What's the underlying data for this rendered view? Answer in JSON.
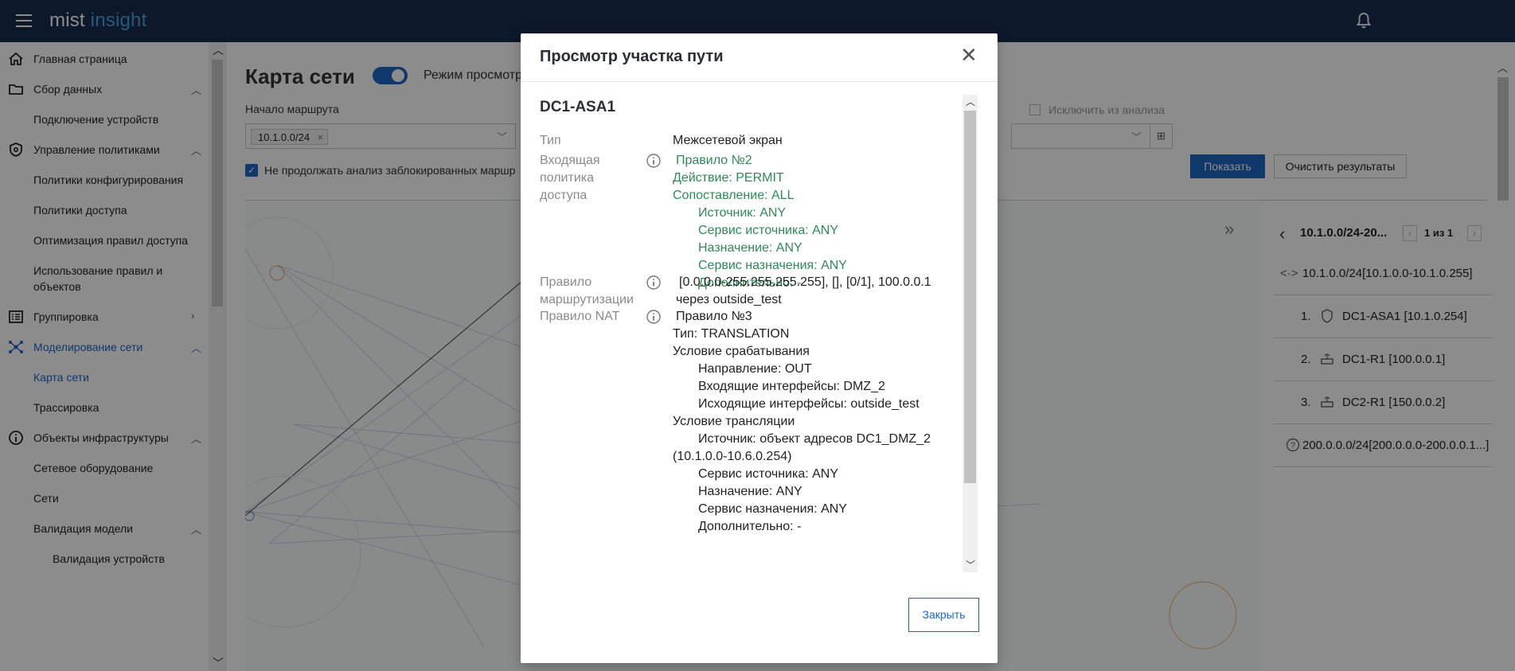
{
  "app": {
    "logo_part1": "mist",
    "logo_part2": "insight"
  },
  "sidebar": {
    "items": [
      {
        "label": "Главная страница"
      },
      {
        "label": "Сбор данных"
      },
      {
        "label": "Подключение устройств"
      },
      {
        "label": "Управление политиками"
      },
      {
        "label": "Политики конфигурирования"
      },
      {
        "label": "Политики доступа"
      },
      {
        "label": "Оптимизация правил доступа"
      },
      {
        "label": "Использование правил и"
      },
      {
        "label": "объектов"
      },
      {
        "label": "Группировка"
      },
      {
        "label": "Моделирование сети"
      },
      {
        "label": "Карта сети"
      },
      {
        "label": "Трассировка"
      },
      {
        "label": "Объекты инфраструктуры"
      },
      {
        "label": "Сетевое оборудование"
      },
      {
        "label": "Сети"
      },
      {
        "label": "Валидация модели"
      },
      {
        "label": "Валидация устройств"
      }
    ],
    "active_color": "#1f66c4"
  },
  "main": {
    "title": "Карта сети",
    "mode_label": "Режим просмотр",
    "route_start_label": "Начало маршрута",
    "route_chip": "10.1.0.0/24",
    "no_continue_label": "Не продолжать анализ заблокированных маршр",
    "exclude_label": "Исключить из анализа",
    "show_button": "Показать",
    "clear_button": "Очистить результаты"
  },
  "path_panel": {
    "title": "10.1.0.0/24-20...",
    "counter": "1 из 1",
    "source": "10.1.0.0/24[10.1.0.0-10.1.0.255]",
    "hops": [
      {
        "num": "1.",
        "label": "DC1-ASA1 [10.1.0.254]",
        "icon": "shield-icon"
      },
      {
        "num": "2.",
        "label": "DC1-R1 [100.0.0.1]",
        "icon": "router-icon"
      },
      {
        "num": "3.",
        "label": "DC2-R1 [150.0.0.2]",
        "icon": "router-icon"
      }
    ],
    "destination": "200.0.0.0/24[200.0.0.0-200.0.0.1...]"
  },
  "modal": {
    "title": "Просмотр участка пути",
    "device": "DC1-ASA1",
    "type_label": "Тип",
    "type_value": "Межсетевой экран",
    "inbound_label_1": "Входящая",
    "inbound_label_2": "политика",
    "inbound_label_3": "доступа",
    "inbound": {
      "rule": "Правило №2",
      "action": "Действие: PERMIT",
      "match": "Сопоставление: ALL",
      "source": "Источник: ANY",
      "source_service": "Сервис источника: ANY",
      "destination": "Назначение: ANY",
      "destination_service": "Сервис назначения: ANY",
      "extra": "Дополнительно: -"
    },
    "routing_label_1": "Правило",
    "routing_label_2": "маршрутизации",
    "routing_value_1": "[0.0.0.0-255.255.255.255], [], [0/1], 100.0.0.1",
    "routing_value_2": "через outside_test",
    "nat_label": "Правило NAT",
    "nat": {
      "rule": "Правило №3",
      "type": "Тип: TRANSLATION",
      "trigger": "Условие срабатывания",
      "direction": "Направление: OUT",
      "in_ifaces": "Входящие интерфейсы: DMZ_2",
      "out_ifaces": "Исходящие интерфейсы: outside_test",
      "translation": "Условие трансляции",
      "source_1": "Источник: объект адресов DC1_DMZ_2",
      "source_2": "(10.1.0.0-10.6.0.254)",
      "source_service": "Сервис источника: ANY",
      "destination": "Назначение: ANY",
      "destination_service": "Сервис назначения: ANY",
      "extra": "Дополнительно: -"
    },
    "close_button": "Закрыть"
  },
  "colors": {
    "topbar": "#1b2d4f",
    "primary": "#1f66c4",
    "policy_green": "#2e8a57"
  }
}
